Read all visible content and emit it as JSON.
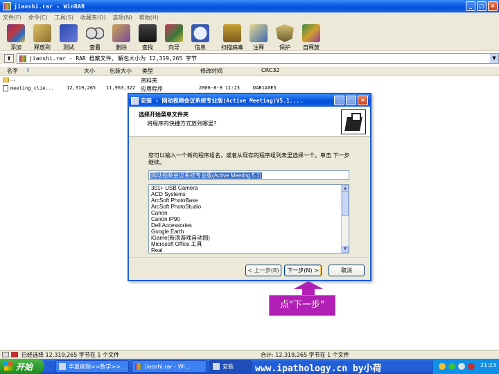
{
  "window": {
    "title": "jiaoshi.rar - WinRAR"
  },
  "menu": [
    "文件(F)",
    "命令(C)",
    "工具(S)",
    "收藏夹(O)",
    "选项(N)",
    "帮助(H)"
  ],
  "toolbar": [
    {
      "label": "添加",
      "icon": "add-icon"
    },
    {
      "label": "释放到",
      "icon": "extract-icon"
    },
    {
      "label": "测试",
      "icon": "test-icon"
    },
    {
      "label": "查看",
      "icon": "view-icon"
    },
    {
      "label": "删除",
      "icon": "delete-icon"
    },
    {
      "label": "查找",
      "icon": "find-icon"
    },
    {
      "label": "向导",
      "icon": "wizard-icon"
    },
    {
      "label": "信息",
      "icon": "info-icon"
    },
    {
      "label": "扫描病毒",
      "icon": "scan-icon"
    },
    {
      "label": "注释",
      "icon": "comment-icon"
    },
    {
      "label": "保护",
      "icon": "protect-icon"
    },
    {
      "label": "自释放",
      "icon": "sfx-icon"
    }
  ],
  "address": {
    "text": "jiaoshi.rar - RAR 档案文件, 解包大小为 12,319,265 字节"
  },
  "columns": [
    "名字",
    "大小",
    "包装大小",
    "类型",
    "修改时间",
    "CRC32"
  ],
  "files": [
    {
      "name": "..",
      "size": "",
      "packed": "",
      "type": "资料夹",
      "modified": "",
      "crc": ""
    },
    {
      "name": "meeting_clie...",
      "size": "12,319,265",
      "packed": "11,963,322",
      "type": "应用程序",
      "modified": "2006-8-9 11:23",
      "crc": "DAB1A0E5"
    }
  ],
  "dialog": {
    "title": "安装 - 网动视频会议系统专业版(Active Meeting)V5.1....",
    "heading": "选择开始菜单文件夹",
    "subheading": "将程序的快捷方式放到哪里?",
    "description": "您可以输入一个新的程序组名，或者从现存的程序组列表里选择一个。单击 下一步 继续。",
    "input_value": "网动视频会议系统专业版(Active Meeting 5.1)",
    "list": [
      "301+ USB Camera",
      "ACD Systems",
      "ArcSoft PhotoBase",
      "ArcSoft PhotoStudio",
      "Canon",
      "Canon iP90",
      "Dell Accessories",
      "Google Earth",
      "iGame(新浪游戏自动园)",
      "Microsoft Office 工具",
      "Real"
    ],
    "back_label": "< 上一步(B)",
    "next_label": "下一步(N) >",
    "cancel_label": "取消"
  },
  "annotation": {
    "text": "点\"下一步\""
  },
  "status": {
    "left": "已经选择 12,319,265 字节在 1 个文件",
    "right": "合计: 12,319,265 字节在 1 个文件"
  },
  "taskbar": {
    "start_label": "开始",
    "tasks": [
      "华夏病理>>数学>>...",
      "jiaoshi.rar - Wi...",
      "安装"
    ],
    "watermark": "www.ipathology.cn  by小荷",
    "clock": "21:23"
  },
  "colors": {
    "accent": "#b21fb5",
    "titlebar": "#0a5ae0"
  }
}
